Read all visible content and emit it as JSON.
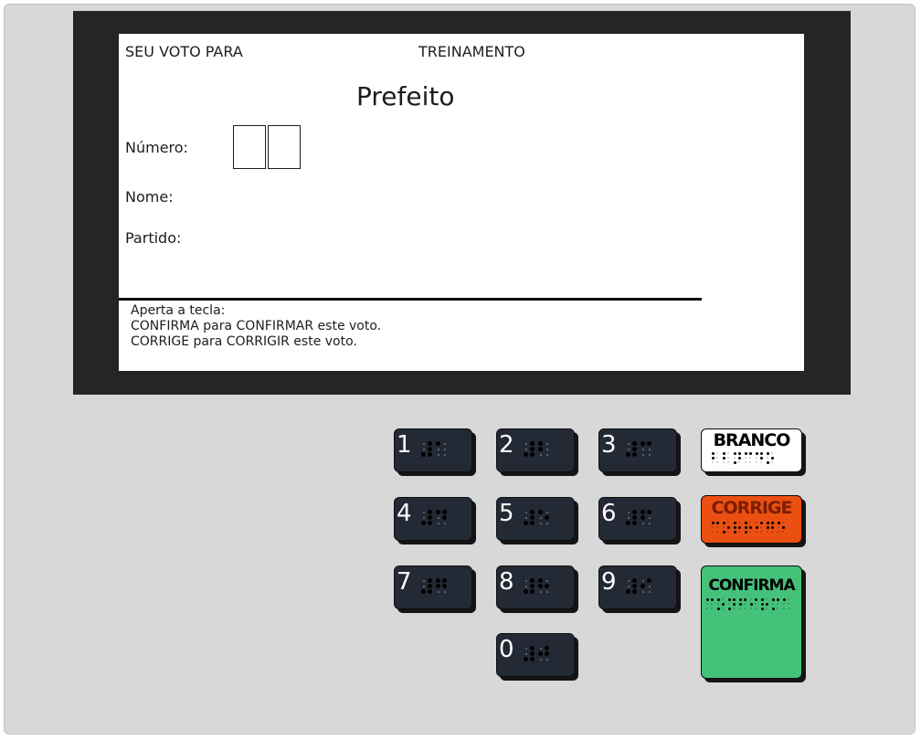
{
  "screen": {
    "header_left": "SEU VOTO PARA",
    "header_center": "TREINAMENTO",
    "office": "Prefeito",
    "number_label": "Número:",
    "name_label": "Nome:",
    "party_label": "Partido:",
    "number_digits": [
      "",
      ""
    ],
    "instructions": [
      "Aperta a tecla:",
      "CONFIRMA para CONFIRMAR este voto.",
      "CORRIGE para CORRIGIR este voto."
    ]
  },
  "keypad": {
    "digit_keys": [
      {
        "label": "1",
        "braille": [
          [
            3,
            4,
            5,
            6
          ],
          [
            1
          ]
        ],
        "icon": "braille-pattern-icon"
      },
      {
        "label": "2",
        "braille": [
          [
            3,
            4,
            5,
            6
          ],
          [
            1,
            2
          ]
        ],
        "icon": "braille-pattern-icon"
      },
      {
        "label": "3",
        "braille": [
          [
            3,
            4,
            5,
            6
          ],
          [
            1,
            4
          ]
        ],
        "icon": "braille-pattern-icon"
      },
      {
        "label": "4",
        "braille": [
          [
            3,
            4,
            5,
            6
          ],
          [
            1,
            4,
            5
          ]
        ],
        "icon": "braille-pattern-icon"
      },
      {
        "label": "5",
        "braille": [
          [
            3,
            4,
            5,
            6
          ],
          [
            1,
            5
          ]
        ],
        "icon": "braille-pattern-icon"
      },
      {
        "label": "6",
        "braille": [
          [
            3,
            4,
            5,
            6
          ],
          [
            1,
            2,
            4
          ]
        ],
        "icon": "braille-pattern-icon"
      },
      {
        "label": "7",
        "braille": [
          [
            3,
            4,
            5,
            6
          ],
          [
            1,
            2,
            4,
            5
          ]
        ],
        "icon": "braille-pattern-icon"
      },
      {
        "label": "8",
        "braille": [
          [
            3,
            4,
            5,
            6
          ],
          [
            1,
            2,
            5
          ]
        ],
        "icon": "braille-pattern-icon"
      },
      {
        "label": "9",
        "braille": [
          [
            3,
            4,
            5,
            6
          ],
          [
            2,
            4
          ]
        ],
        "icon": "braille-pattern-icon"
      },
      {
        "label": "0",
        "braille": [
          [
            3,
            4,
            5,
            6
          ],
          [
            2,
            4,
            5
          ]
        ],
        "icon": "braille-pattern-icon"
      }
    ],
    "branco": {
      "label": "BRANCO",
      "color": "#ffffff",
      "braille": [
        [
          1,
          2
        ],
        [
          1,
          2
        ],
        [
          1,
          3,
          4,
          5
        ],
        [
          1,
          4
        ],
        [
          1,
          4,
          5
        ],
        [
          1,
          3,
          5
        ]
      ]
    },
    "corrige": {
      "label": "CORRIGE",
      "color": "#eb4f12",
      "braille": [
        [
          1,
          4
        ],
        [
          1,
          3,
          5
        ],
        [
          1,
          2,
          3,
          5
        ],
        [
          1,
          2,
          3,
          5
        ],
        [
          2,
          4
        ],
        [
          1,
          2,
          4,
          5
        ],
        [
          1,
          5
        ]
      ]
    },
    "confirma": {
      "label": "CONFIRMA",
      "color": "#45c27a",
      "braille": [
        [
          1,
          4
        ],
        [
          1,
          3,
          5
        ],
        [
          1,
          3,
          4,
          5
        ],
        [
          1,
          2,
          4
        ],
        [
          2,
          4
        ],
        [
          1,
          2,
          3,
          5
        ],
        [
          1,
          3,
          4
        ],
        [
          1
        ]
      ]
    }
  },
  "colors": {
    "body": "#d8d8d8",
    "bezel": "#252525",
    "digit_key": "#242a35"
  }
}
